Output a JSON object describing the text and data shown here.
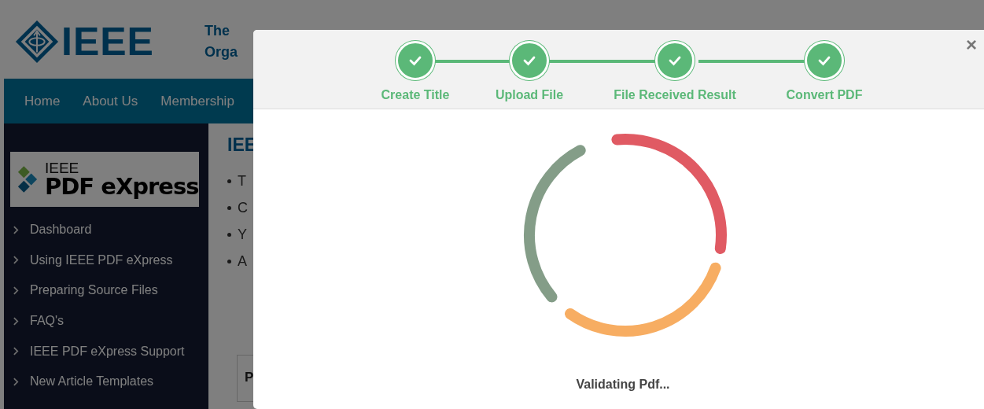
{
  "header": {
    "logo_text": "IEEE",
    "tagline": [
      "The",
      "Orga"
    ]
  },
  "nav": {
    "items": [
      "Home",
      "About Us",
      "Membership"
    ]
  },
  "sidebar": {
    "logo": {
      "small": "IEEE",
      "large": "PDF eXpress"
    },
    "items": [
      "Dashboard",
      "Using IEEE PDF eXpress",
      "Preparing Source Files",
      "FAQ's",
      "IEEE PDF eXpress Support",
      "New Article Templates"
    ]
  },
  "content": {
    "heading": "IEE",
    "bullets": [
      "T",
      "C",
      "Y",
      "A"
    ],
    "table_cell": "P"
  },
  "modal": {
    "close": "×",
    "steps": [
      {
        "label": "Create Title",
        "done": true
      },
      {
        "label": "Upload File",
        "done": true
      },
      {
        "label": "File Received Result",
        "done": true
      },
      {
        "label": "Convert PDF",
        "done": true
      }
    ],
    "status": "Validating Pdf..."
  }
}
